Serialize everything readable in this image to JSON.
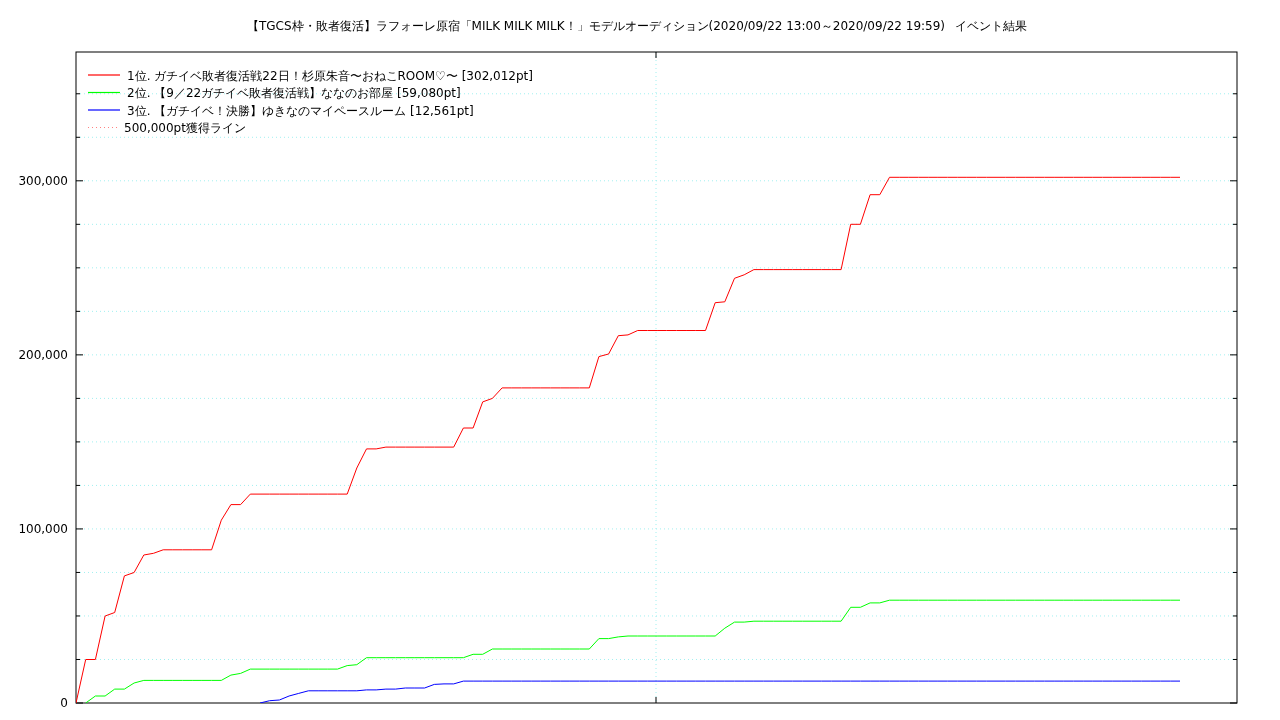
{
  "caption": "イベント結果",
  "chart_data": {
    "type": "line",
    "title": "【TGCS枠・敗者復活】ラフォーレ原宿「MILK MILK MILK！」モデルオーディション(2020/09/22 13:00～2020/09/22 19:59)",
    "ylim": [
      0,
      374000
    ],
    "categories": [
      null,
      null,
      null,
      null,
      null,
      null,
      null,
      null,
      null,
      null,
      null,
      null,
      null,
      null,
      null,
      null,
      null,
      null,
      null,
      null,
      null,
      null,
      null,
      null,
      null,
      null,
      null,
      null,
      null,
      null,
      null,
      null,
      null,
      null,
      null,
      null,
      null,
      null,
      null,
      null,
      null,
      null,
      null,
      null,
      null,
      null,
      null,
      null,
      null,
      null,
      null,
      null,
      null,
      null,
      null,
      null,
      null,
      null,
      null,
      null,
      null,
      null,
      null,
      null,
      null,
      null,
      null,
      null,
      null,
      null,
      null,
      null,
      null,
      null,
      null,
      null,
      null,
      null,
      null,
      null,
      null,
      null,
      null,
      null,
      null,
      null,
      null,
      null,
      null,
      null,
      null,
      null,
      null,
      null,
      null,
      null,
      null,
      null,
      null,
      null,
      null,
      null,
      null,
      null,
      null,
      null,
      null,
      null,
      null,
      null,
      null,
      null,
      null,
      null,
      null
    ],
    "yticks": [
      {
        "value": 0,
        "label": "0"
      },
      {
        "value": 100000,
        "label": "100,000"
      },
      {
        "value": 200000,
        "label": "200,000"
      },
      {
        "value": 300000,
        "label": "300,000"
      }
    ],
    "series": [
      {
        "name": "1位. ガチイベ敗者復活戦22日！杉原朱音〜おねこROOM♡〜 [302,012pt]",
        "color": "#ff0000",
        "values": [
          0,
          25000,
          25000,
          50000,
          52000,
          73000,
          75000,
          85000,
          86000,
          88000,
          88000,
          88000,
          88000,
          88000,
          88000,
          105000,
          114000,
          114000,
          120000,
          120000,
          120000,
          120000,
          120000,
          120000,
          120000,
          120000,
          120000,
          120000,
          120000,
          135000,
          146000,
          146000,
          147000,
          147000,
          147000,
          147000,
          147000,
          147000,
          147000,
          147000,
          158000,
          158000,
          173000,
          175000,
          181000,
          181000,
          181000,
          181000,
          181000,
          181000,
          181000,
          181000,
          181000,
          181000,
          199000,
          200500,
          211000,
          211500,
          214000,
          214000,
          214000,
          214000,
          214000,
          214000,
          214000,
          214000,
          230000,
          230500,
          244000,
          246000,
          249000,
          249000,
          249000,
          249000,
          249000,
          249000,
          249000,
          249000,
          249000,
          249000,
          275000,
          275000,
          292000,
          292000,
          302012,
          302012,
          302012,
          302012,
          302012,
          302012,
          302012,
          302012,
          302012,
          302012,
          302012,
          302012,
          302012,
          302012,
          302012,
          302012,
          302012,
          302012,
          302012,
          302012,
          302012,
          302012,
          302012,
          302012,
          302012,
          302012,
          302012,
          302012,
          302012,
          302012,
          302012
        ]
      },
      {
        "name": "2位. 【9／22ガチイベ敗者復活戦】ななのお部屋 [59,080pt]",
        "color": "#00ff00",
        "values": [
          null,
          0,
          4000,
          4000,
          8000,
          8000,
          11500,
          13000,
          13000,
          13000,
          13000,
          13000,
          13000,
          13000,
          13000,
          13000,
          16000,
          17000,
          19500,
          19500,
          19500,
          19500,
          19500,
          19500,
          19500,
          19500,
          19500,
          19500,
          21500,
          22000,
          26000,
          26000,
          26000,
          26000,
          26000,
          26000,
          26000,
          26000,
          26000,
          26000,
          26000,
          28000,
          28000,
          31000,
          31000,
          31000,
          31000,
          31000,
          31000,
          31000,
          31000,
          31000,
          31000,
          31000,
          37000,
          37000,
          38000,
          38500,
          38500,
          38500,
          38500,
          38500,
          38500,
          38500,
          38500,
          38500,
          38500,
          43000,
          46500,
          46500,
          47000,
          47000,
          47000,
          47000,
          47000,
          47000,
          47000,
          47000,
          47000,
          47000,
          55000,
          55000,
          57500,
          57500,
          59080,
          59080,
          59080,
          59080,
          59080,
          59080,
          59080,
          59080,
          59080,
          59080,
          59080,
          59080,
          59080,
          59080,
          59080,
          59080,
          59080,
          59080,
          59080,
          59080,
          59080,
          59080,
          59080,
          59080,
          59080,
          59080,
          59080,
          59080,
          59080,
          59080,
          59080
        ]
      },
      {
        "name": "3位. 【ガチイベ！決勝】ゆきなのマイペースルーム [12,561pt]",
        "color": "#0000ff",
        "values": [
          null,
          null,
          null,
          null,
          null,
          null,
          null,
          null,
          null,
          null,
          null,
          null,
          null,
          null,
          null,
          null,
          null,
          null,
          null,
          0,
          1300,
          1700,
          4000,
          5500,
          7000,
          7000,
          7000,
          7000,
          7000,
          7000,
          7500,
          7500,
          8000,
          8000,
          8600,
          8600,
          8600,
          10700,
          11000,
          11000,
          12561,
          12561,
          12561,
          12561,
          12561,
          12561,
          12561,
          12561,
          12561,
          12561,
          12561,
          12561,
          12561,
          12561,
          12561,
          12561,
          12561,
          12561,
          12561,
          12561,
          12561,
          12561,
          12561,
          12561,
          12561,
          12561,
          12561,
          12561,
          12561,
          12561,
          12561,
          12561,
          12561,
          12561,
          12561,
          12561,
          12561,
          12561,
          12561,
          12561,
          12561,
          12561,
          12561,
          12561,
          12561,
          12561,
          12561,
          12561,
          12561,
          12561,
          12561,
          12561,
          12561,
          12561,
          12561,
          12561,
          12561,
          12561,
          12561,
          12561,
          12561,
          12561,
          12561,
          12561,
          12561,
          12561,
          12561,
          12561,
          12561,
          12561,
          12561,
          12561,
          12561,
          12561,
          12561
        ]
      }
    ],
    "grid": true,
    "legend": true,
    "ref_lines": [
      {
        "label": "500,000pt獲得ライン",
        "color": "#ff8080"
      }
    ]
  }
}
